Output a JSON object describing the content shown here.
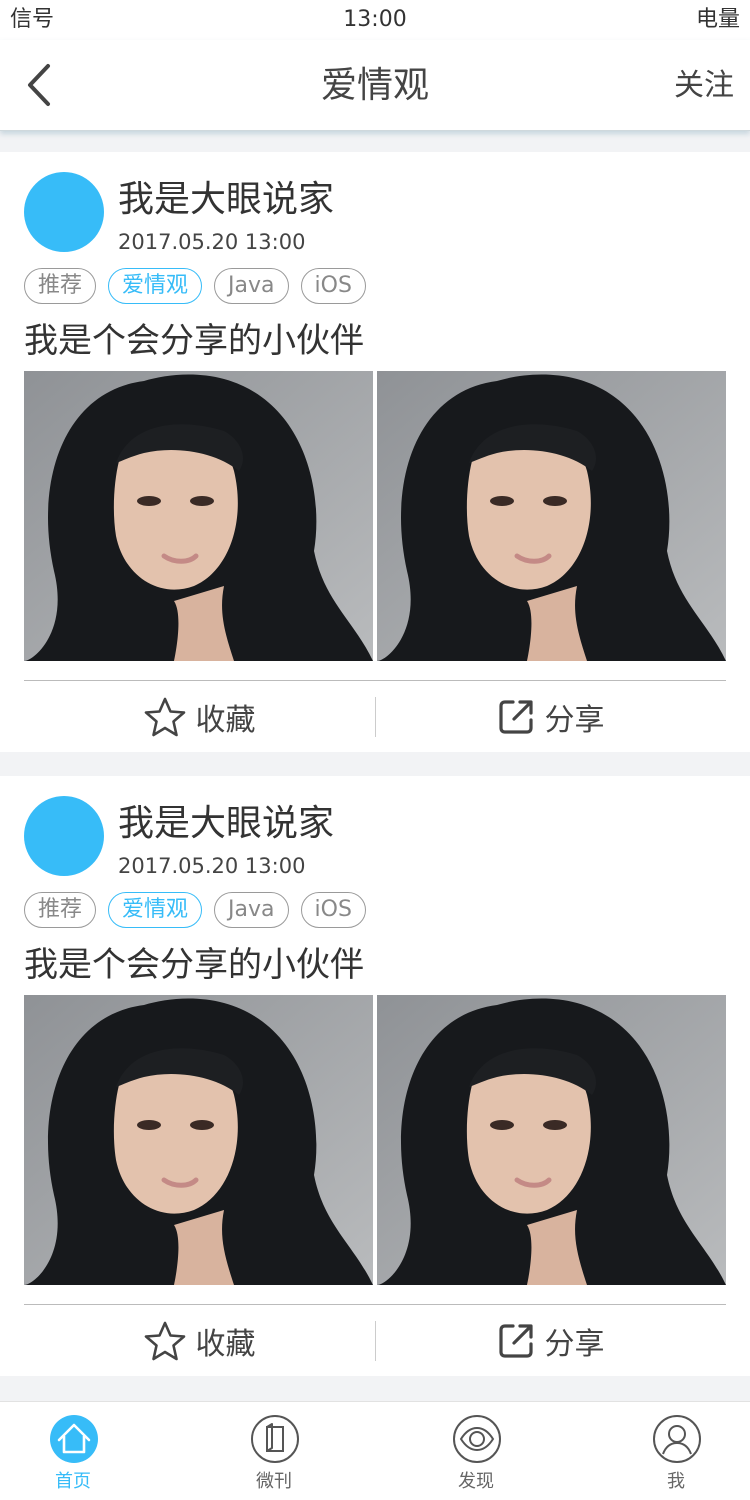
{
  "status_bar": {
    "signal": "信号",
    "time": "13:00",
    "battery": "电量"
  },
  "nav": {
    "title": "爱情观",
    "follow_label": "关注",
    "back_icon": "chevron-left-icon"
  },
  "posts": [
    {
      "author": "我是大眼说家",
      "date": "2017.05.20   13:00",
      "tags": [
        "推荐",
        "爱情观",
        "Java",
        "iOS"
      ],
      "active_tag": "爱情观",
      "text": "我是个会分享的小伙伴",
      "favorite_label": "收藏",
      "share_label": "分享"
    },
    {
      "author": "我是大眼说家",
      "date": "2017.05.20   13:00",
      "tags": [
        "推荐",
        "爱情观",
        "Java",
        "iOS"
      ],
      "active_tag": "爱情观",
      "text": "我是个会分享的小伙伴",
      "favorite_label": "收藏",
      "share_label": "分享"
    }
  ],
  "tab_bar": {
    "items": [
      {
        "label": "首页",
        "icon": "home-icon",
        "active": true
      },
      {
        "label": "微刊",
        "icon": "magazine-icon",
        "active": false
      },
      {
        "label": "发现",
        "icon": "eye-icon",
        "active": false
      },
      {
        "label": "我",
        "icon": "user-icon",
        "active": false
      }
    ]
  },
  "colors": {
    "accent": "#37bcf8",
    "text": "#333333",
    "background": "#f2f3f5"
  }
}
